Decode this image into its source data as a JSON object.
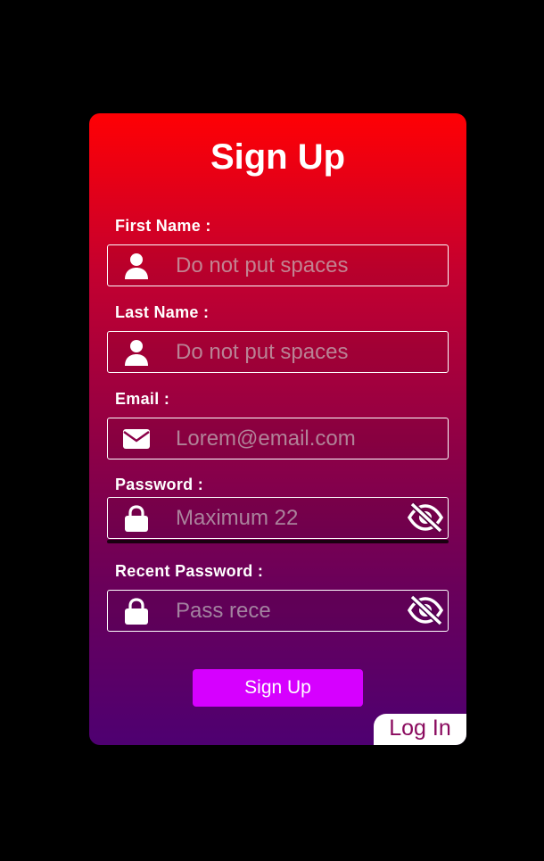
{
  "form": {
    "title": "Sign Up",
    "fields": [
      {
        "label": "First Name :",
        "placeholder": "Do not put spaces",
        "icon": "user-icon"
      },
      {
        "label": "Last Name :",
        "placeholder": "Do not put spaces",
        "icon": "user-icon"
      },
      {
        "label": "Email :",
        "placeholder": "Lorem@email.com",
        "icon": "envelope-icon"
      },
      {
        "label": "Password :",
        "placeholder": "Maximum 22",
        "icon": "lock-icon",
        "toggle_icon": "eye-slash-icon"
      },
      {
        "label": "Recent Password :",
        "placeholder": "Pass rece",
        "icon": "lock-icon",
        "toggle_icon": "eye-slash-icon"
      }
    ],
    "submit_label": "Sign Up",
    "login_label": "Log In"
  },
  "colors": {
    "page_background": "#000000",
    "gradient_top": "#ff0004",
    "gradient_bottom": "#4e0071",
    "button": "#d600ff",
    "login_text": "#8a0a5e"
  }
}
